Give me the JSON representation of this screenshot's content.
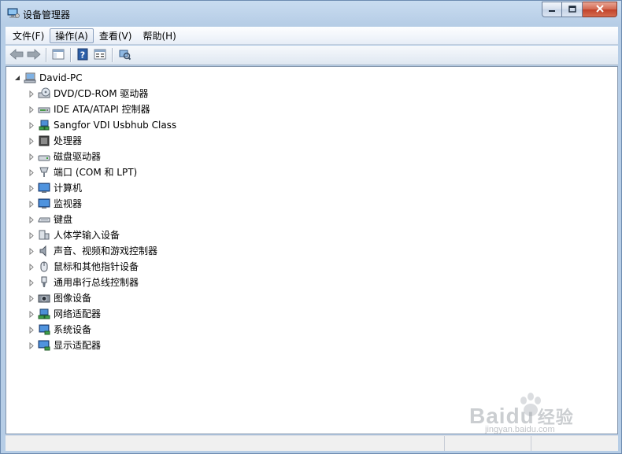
{
  "window": {
    "title": "设备管理器"
  },
  "menu": [
    {
      "label": "文件(F)",
      "active": false
    },
    {
      "label": "操作(A)",
      "active": true
    },
    {
      "label": "查看(V)",
      "active": false
    },
    {
      "label": "帮助(H)",
      "active": false
    }
  ],
  "toolbar": {
    "buttons": [
      "back-icon",
      "forward-icon",
      "show-hide-tree-icon",
      "help-icon",
      "properties-icon",
      "scan-hardware-icon"
    ]
  },
  "tree": {
    "root": {
      "label": "David-PC",
      "icon": "computer-icon",
      "expanded": true
    },
    "children": [
      {
        "label": "DVD/CD-ROM 驱动器",
        "icon": "dvd-drive-icon"
      },
      {
        "label": "IDE ATA/ATAPI 控制器",
        "icon": "ide-controller-icon"
      },
      {
        "label": "Sangfor VDI Usbhub Class",
        "icon": "network-device-icon"
      },
      {
        "label": "处理器",
        "icon": "processor-icon"
      },
      {
        "label": "磁盘驱动器",
        "icon": "disk-drive-icon"
      },
      {
        "label": "端口 (COM 和 LPT)",
        "icon": "port-icon"
      },
      {
        "label": "计算机",
        "icon": "monitor-icon"
      },
      {
        "label": "监视器",
        "icon": "monitor-icon"
      },
      {
        "label": "键盘",
        "icon": "keyboard-icon"
      },
      {
        "label": "人体学输入设备",
        "icon": "hid-icon"
      },
      {
        "label": "声音、视频和游戏控制器",
        "icon": "speaker-icon"
      },
      {
        "label": "鼠标和其他指针设备",
        "icon": "mouse-icon"
      },
      {
        "label": "通用串行总线控制器",
        "icon": "usb-icon"
      },
      {
        "label": "图像设备",
        "icon": "camera-icon"
      },
      {
        "label": "网络适配器",
        "icon": "network-adapter-icon"
      },
      {
        "label": "系统设备",
        "icon": "system-device-icon"
      },
      {
        "label": "显示适配器",
        "icon": "display-adapter-icon"
      }
    ]
  },
  "watermark": {
    "brand": "Baidu",
    "suffix": "经验",
    "url": "jingyan.baidu.com"
  }
}
